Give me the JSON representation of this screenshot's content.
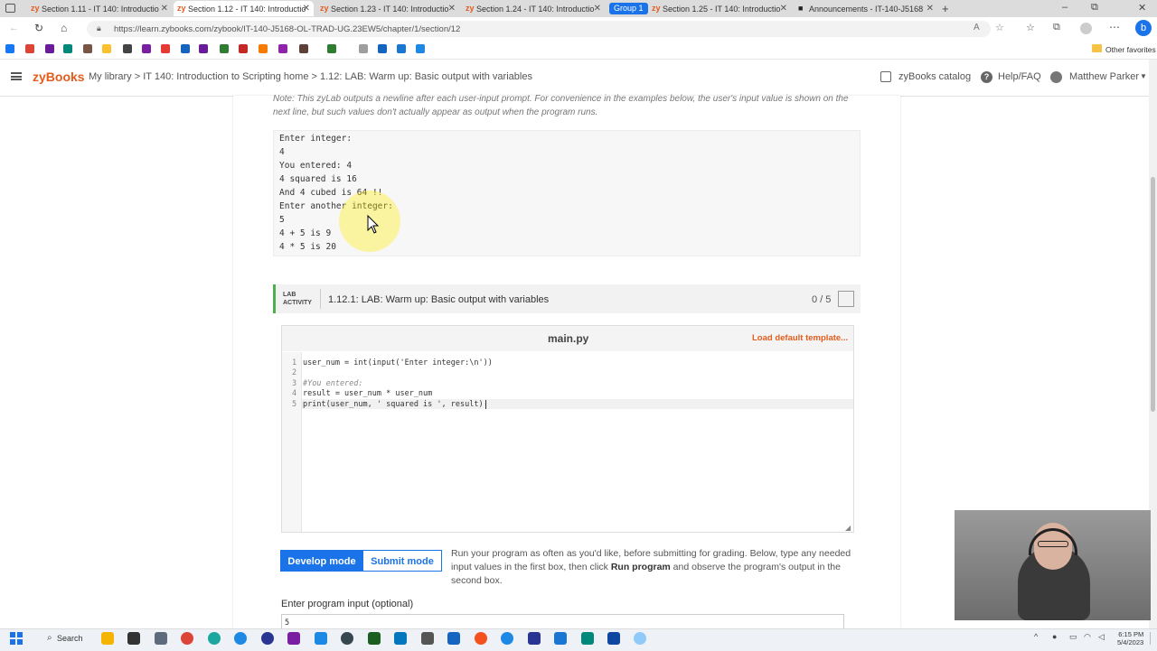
{
  "tabs": [
    {
      "label": "Section 1.11 - IT 140: Introductio"
    },
    {
      "label": "Section 1.12 - IT 140: Introductio"
    },
    {
      "label": "Section 1.23 - IT 140: Introductio"
    },
    {
      "label": "Section 1.24 - IT 140: Introductio"
    },
    {
      "label": "Group 1"
    },
    {
      "label": "Section 1.25 - IT 140: Introductio"
    },
    {
      "label": "Announcements - IT-140-J5168"
    }
  ],
  "tab_zy_glyph": "zy",
  "address": {
    "url": "https://learn.zybooks.com/zybook/IT-140-J5168-OL-TRAD-UG.23EW5/chapter/1/section/12"
  },
  "favorites": {
    "other_label": "Other favorites"
  },
  "header": {
    "logo": "zyBooks",
    "breadcrumb": "My library > IT 140: Introduction to Scripting home > 1.12: LAB: Warm up: Basic output with variables",
    "catalog": "zyBooks catalog",
    "help": "Help/FAQ",
    "user": "Matthew Parker"
  },
  "note": "Note: This zyLab outputs a newline after each user-input prompt. For convenience in the examples below, the user's input value is shown on the next line, but such values don't actually appear as output when the program runs.",
  "example_lines": [
    "Enter integer:",
    "4",
    "You entered: 4",
    "4 squared is 16",
    "And 4 cubed is 64 !!",
    "Enter another integer:",
    "5",
    "4 + 5 is 9",
    "4 * 5 is 20"
  ],
  "lab": {
    "tag_line1": "LAB",
    "tag_line2": "ACTIVITY",
    "title": "1.12.1: LAB: Warm up: Basic output with variables",
    "score": "0 / 5",
    "filename": "main.py",
    "load_template": "Load default template...",
    "code_lines": [
      {
        "n": "1",
        "text": "user_num = int(input('Enter integer:\\n'))"
      },
      {
        "n": "2",
        "text": ""
      },
      {
        "n": "3",
        "text": "#You entered:"
      },
      {
        "n": "4",
        "text": "result = user_num * user_num"
      },
      {
        "n": "5",
        "text": "print(user_num, ' squared is ', result)"
      }
    ],
    "develop_mode": "Develop mode",
    "submit_mode": "Submit mode",
    "help_pre": "Run your program as often as you'd like, before submitting for grading. Below, type any needed input values in the first box, then click ",
    "help_bold": "Run program",
    "help_post": " and observe the program's output in the second box.",
    "input_label": "Enter program input (optional)",
    "input_value": "5"
  },
  "taskbar": {
    "search": "Search",
    "time": "6:15 PM",
    "date": "5/4/2023"
  },
  "colors": {
    "brand": "#e35d1d",
    "accent_blue": "#1a73e8",
    "lab_green": "#4caf50"
  }
}
